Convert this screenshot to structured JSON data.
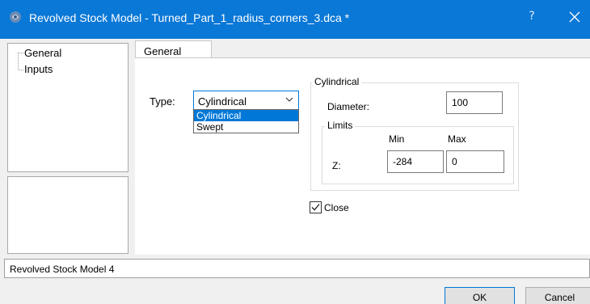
{
  "window": {
    "title": "Revolved Stock Model - Turned_Part_1_radius_corners_3.dca *",
    "help_glyph": "?",
    "accent": "#0a78d7"
  },
  "tree": {
    "items": [
      {
        "label": "General"
      },
      {
        "label": "Inputs"
      }
    ]
  },
  "tabs": [
    {
      "label": "General"
    }
  ],
  "general": {
    "type_label": "Type:",
    "type_value": "Cylindrical",
    "type_options": [
      "Cylindrical",
      "Swept"
    ],
    "cylindrical_title": "Cylindrical",
    "diameter_label": "Diameter:",
    "diameter_value": "100",
    "limits_title": "Limits",
    "min_header": "Min",
    "max_header": "Max",
    "z_label": "Z:",
    "z_min": "-284",
    "z_max": "0",
    "close_label": "Close",
    "close_checked": true
  },
  "status": {
    "name": "Revolved Stock Model 4"
  },
  "buttons": {
    "ok": "OK",
    "cancel": "Cancel"
  }
}
